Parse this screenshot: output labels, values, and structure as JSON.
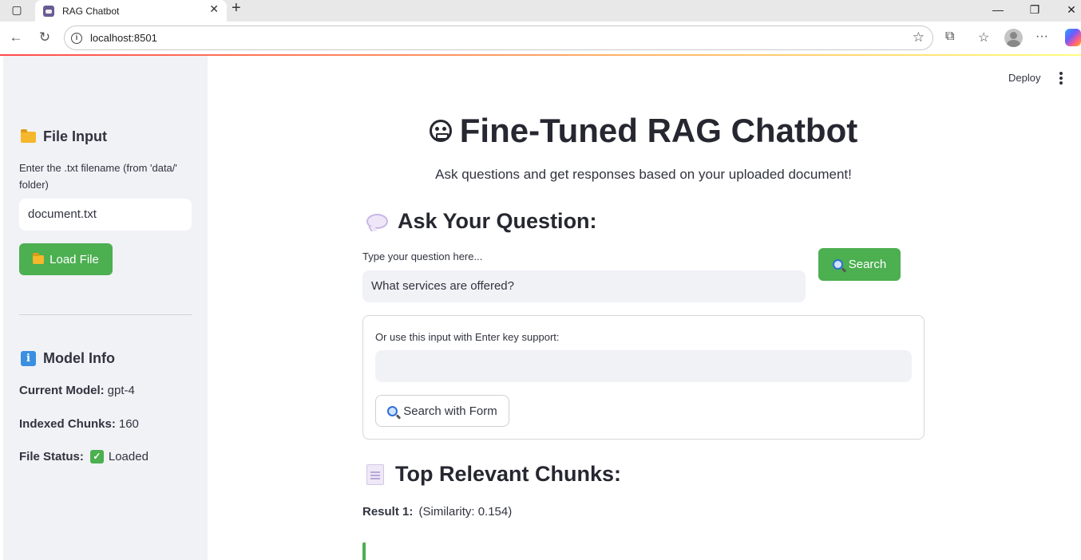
{
  "browser": {
    "tab_title": "RAG Chatbot",
    "url": "localhost:8501"
  },
  "header": {
    "deploy_label": "Deploy"
  },
  "sidebar": {
    "file_input_heading": "File Input",
    "filename_label": "Enter the .txt filename (from 'data/' folder)",
    "filename_value": "document.txt",
    "load_button_label": "Load File",
    "model_info_heading": "Model Info",
    "current_model_label": "Current Model:",
    "current_model_value": "gpt-4",
    "indexed_chunks_label": "Indexed Chunks:",
    "indexed_chunks_value": "160",
    "file_status_label": "File Status:",
    "file_status_value": "Loaded"
  },
  "main": {
    "title": "Fine-Tuned RAG Chatbot",
    "subtitle": "Ask questions and get responses based on your uploaded document!",
    "ask_heading": "Ask Your Question:",
    "question_label": "Type your question here...",
    "question_value": "What services are offered?",
    "search_button_label": "Search",
    "form_label": "Or use this input with Enter key support:",
    "form_input_value": "",
    "form_button_label": "Search with Form",
    "chunks_heading": "Top Relevant Chunks:",
    "result_label": "Result 1:",
    "result_similarity": "(Similarity: 0.154)"
  },
  "colors": {
    "accent_green": "#4caf50",
    "sidebar_bg": "#f0f2f6",
    "text": "#31333f"
  },
  "icons": [
    "window-icon",
    "tab-favicon",
    "close-icon",
    "plus-icon",
    "minimize-icon",
    "restore-icon",
    "back-icon",
    "reload-icon",
    "site-info-icon",
    "star-icon",
    "extensions-icon",
    "favorites-icon",
    "profile-avatar",
    "more-icon",
    "copilot-icon",
    "folder-icon",
    "info-icon",
    "check-icon",
    "bot-icon",
    "speech-bubble-icon",
    "search-icon",
    "document-icon",
    "kebab-menu-icon"
  ]
}
